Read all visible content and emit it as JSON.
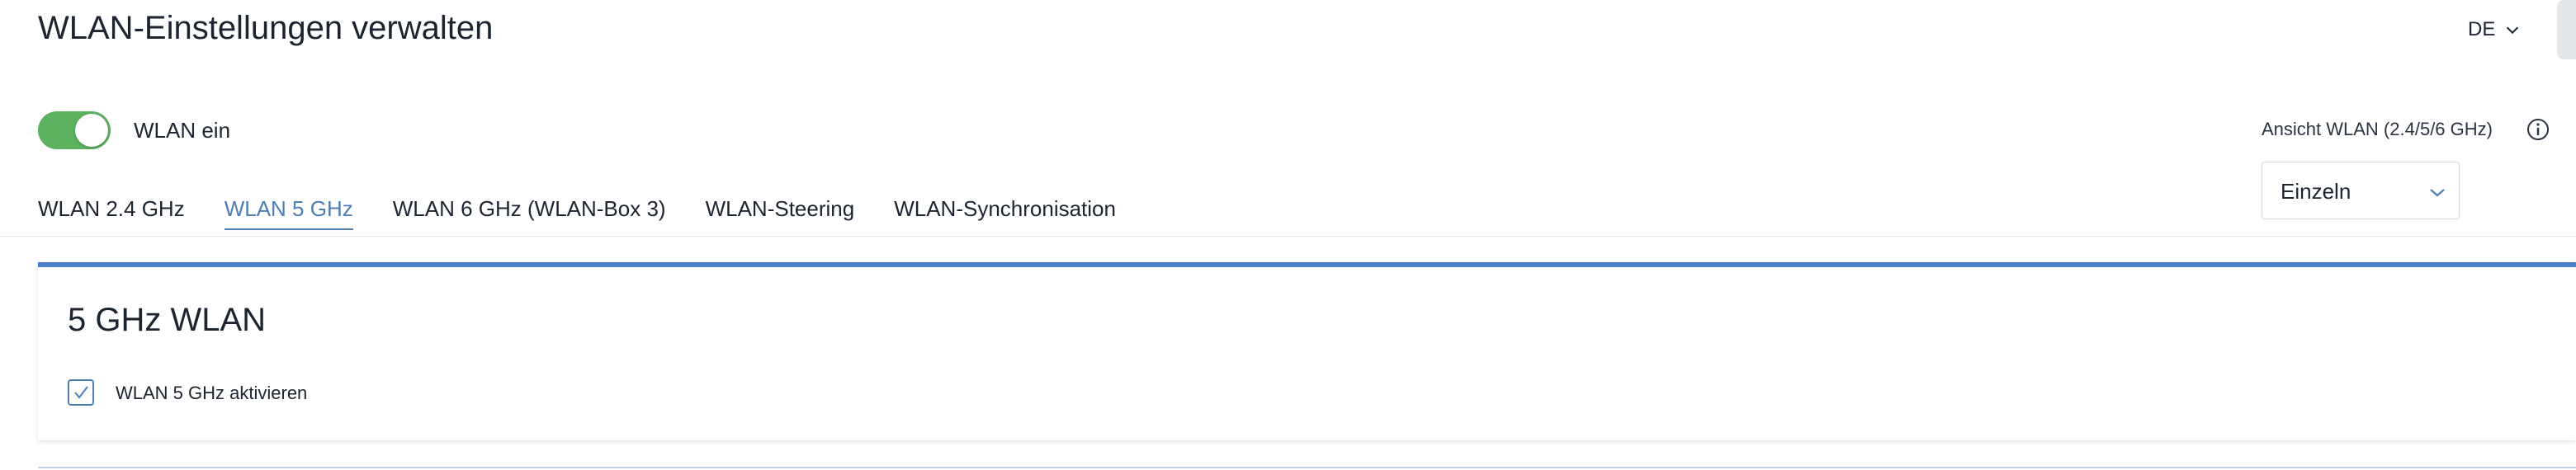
{
  "header": {
    "title": "WLAN-Einstellungen verwalten",
    "language": "DE"
  },
  "wlan_toggle": {
    "label": "WLAN ein",
    "on": true
  },
  "view": {
    "label": "Ansicht WLAN (2.4/5/6 GHz)",
    "selected": "Einzeln"
  },
  "tabs": [
    {
      "label": "WLAN 2.4 GHz",
      "active": false
    },
    {
      "label": "WLAN 5 GHz",
      "active": true
    },
    {
      "label": "WLAN 6 GHz (WLAN-Box 3)",
      "active": false
    },
    {
      "label": "WLAN-Steering",
      "active": false
    },
    {
      "label": "WLAN-Synchronisation",
      "active": false
    }
  ],
  "panel": {
    "title": "5 GHz WLAN",
    "checkbox_label": "WLAN 5 GHz aktivieren",
    "checked": true
  },
  "colors": {
    "accent": "#4d7fb5",
    "toggle_on": "#5bb15e",
    "panel_border": "#4f7fc8"
  },
  "icons": [
    "chevron-down-icon",
    "info-icon",
    "check-icon"
  ]
}
